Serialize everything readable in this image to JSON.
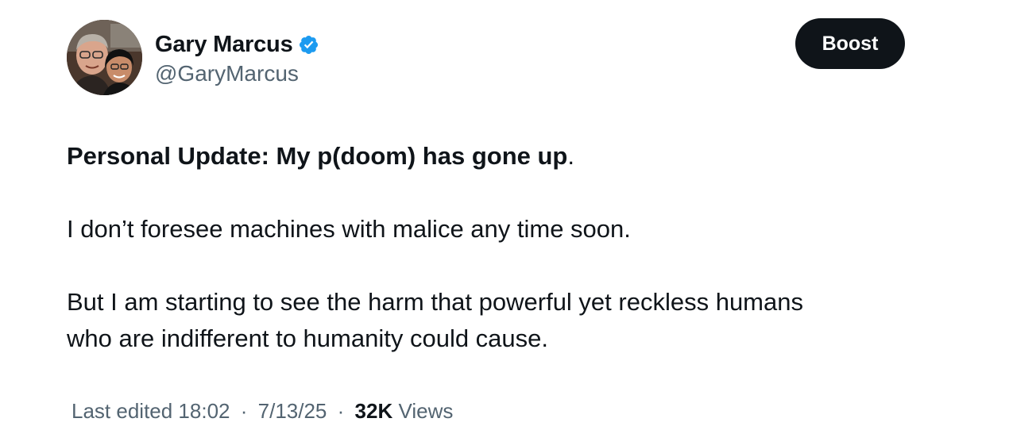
{
  "author": {
    "display_name": "Gary Marcus",
    "handle": "@GaryMarcus",
    "verified_icon": "verified-badge-icon",
    "avatar": "profile-photo"
  },
  "actions": {
    "boost_label": "Boost"
  },
  "tweet": {
    "headline_bold": "Personal Update: My p(doom) has gone up",
    "headline_tail": ".",
    "paragraph_1": "I don’t foresee machines with malice any time soon.",
    "paragraph_2_line_1": "But I am starting to see the harm that powerful yet reckless humans",
    "paragraph_2_line_2": "who are indifferent to humanity could cause."
  },
  "meta": {
    "edited_label": "Last edited 18:02",
    "separator": "·",
    "date": "7/13/25",
    "views_count": "32K",
    "views_label": "Views"
  },
  "colors": {
    "text_primary": "#0f1419",
    "text_secondary": "#536471",
    "verified_blue": "#1d9bf0",
    "boost_background": "#0f1419"
  }
}
